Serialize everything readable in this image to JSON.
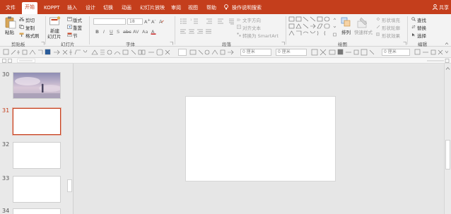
{
  "tabs": [
    "文件",
    "开始",
    "KOPPT",
    "插入",
    "设计",
    "切换",
    "动画",
    "幻灯片放映",
    "审阅",
    "视图",
    "帮助",
    "操作说明搜索"
  ],
  "share_label": "共享",
  "clipboard": {
    "paste": "粘贴",
    "cut": "剪切",
    "copy": "复制",
    "format_painter": "格式刷",
    "group": "剪贴板"
  },
  "slides_group": {
    "new_slide": "新建",
    "new_slide2": "幻灯片",
    "layout": "版式",
    "reset": "重置",
    "section": "节",
    "group": "幻灯片"
  },
  "font_group": {
    "font_size": "18",
    "group": "字体"
  },
  "paragraph_group": {
    "text_direction": "文字方向",
    "align_text": "对齐文本",
    "smartart": "转换为 SmartArt",
    "group": "段落"
  },
  "drawing_group": {
    "arrange": "排列",
    "quick_styles": "快速样式",
    "shape_fill": "形状填充",
    "shape_outline": "形状轮廓",
    "shape_effects": "形状效果",
    "group": "绘图"
  },
  "editing_group": {
    "find": "查找",
    "replace": "替换",
    "select": "选择",
    "group": "编辑"
  },
  "qat": {
    "size1": "0 厘米",
    "size2": "0 厘米",
    "size3": "0 厘米"
  },
  "slides": [
    {
      "num": "30"
    },
    {
      "num": "31"
    },
    {
      "num": "32"
    },
    {
      "num": "33"
    },
    {
      "num": "34"
    }
  ],
  "colors": {
    "accent": "#c43e1c",
    "tab_text": "#ffffff"
  }
}
